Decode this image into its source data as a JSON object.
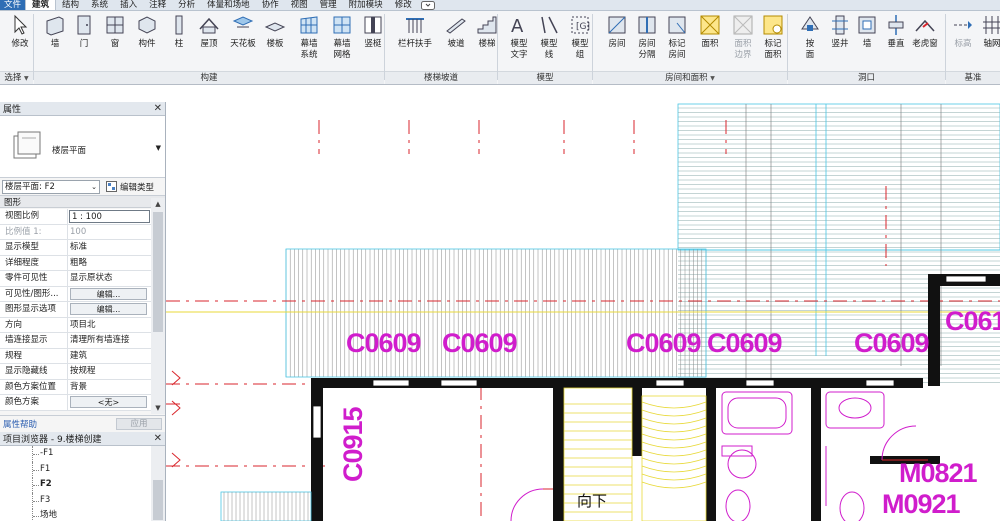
{
  "tabs": [
    "文件",
    "建筑",
    "结构",
    "系统",
    "插入",
    "注释",
    "分析",
    "体量和场地",
    "协作",
    "视图",
    "管理",
    "附加模块",
    "修改"
  ],
  "active_tab": "建筑",
  "ribbon": {
    "tools": [
      {
        "label": "修改",
        "icon": "cursor-icon"
      },
      {
        "label": "墙",
        "icon": "wall-icon"
      },
      {
        "label": "门",
        "icon": "door-icon"
      },
      {
        "label": "窗",
        "icon": "window-icon"
      },
      {
        "label": "构件",
        "icon": "component-icon"
      },
      {
        "label": "柱",
        "icon": "column-icon"
      },
      {
        "label": "屋顶",
        "icon": "roof-icon"
      },
      {
        "label": "天花板",
        "icon": "ceiling-icon"
      },
      {
        "label": "楼板",
        "icon": "floor-icon"
      },
      {
        "label": "幕墙\n系统",
        "icon": "curtain-system-icon"
      },
      {
        "label": "幕墙\n网格",
        "icon": "curtain-grid-icon"
      },
      {
        "label": "竖梃",
        "icon": "mullion-icon"
      },
      {
        "label": "栏杆扶手",
        "icon": "railing-icon"
      },
      {
        "label": "坡道",
        "icon": "ramp-icon"
      },
      {
        "label": "楼梯",
        "icon": "stair-icon"
      },
      {
        "label": "模型\n文字",
        "icon": "model-text-icon"
      },
      {
        "label": "模型\n线",
        "icon": "model-line-icon"
      },
      {
        "label": "模型\n组",
        "icon": "model-group-icon"
      },
      {
        "label": "房间",
        "icon": "room-icon"
      },
      {
        "label": "房间\n分隔",
        "icon": "room-separator-icon"
      },
      {
        "label": "标记\n房间",
        "icon": "tag-room-icon"
      },
      {
        "label": "面积",
        "icon": "area-icon"
      },
      {
        "label": "面积\n边界",
        "icon": "area-boundary-icon"
      },
      {
        "label": "标记\n面积",
        "icon": "tag-area-icon"
      },
      {
        "label": "按\n面",
        "icon": "by-face-icon"
      },
      {
        "label": "竖井",
        "icon": "shaft-icon"
      },
      {
        "label": "墙",
        "icon": "wall-opening-icon"
      },
      {
        "label": "垂直",
        "icon": "vertical-opening-icon"
      },
      {
        "label": "老虎窗",
        "icon": "dormer-icon"
      },
      {
        "label": "标高",
        "icon": "level-icon"
      },
      {
        "label": "轴网",
        "icon": "grid-icon"
      }
    ],
    "groups": [
      "选择",
      "构建",
      "楼梯坡道",
      "模型",
      "房间和面积",
      "洞口",
      "基准"
    ]
  },
  "properties": {
    "title": "属性",
    "type_name": "楼层平面",
    "filter": "楼层平面: F2",
    "edit_type": "编辑类型",
    "group": "图形",
    "rows": [
      {
        "k": "视图比例",
        "v": "1 : 100"
      },
      {
        "k": "比例值 1:",
        "v": "100"
      },
      {
        "k": "显示模型",
        "v": "标准"
      },
      {
        "k": "详细程度",
        "v": "粗略"
      },
      {
        "k": "零件可见性",
        "v": "显示原状态"
      },
      {
        "k": "可见性/图形...",
        "v": "编辑..."
      },
      {
        "k": "图形显示选项",
        "v": "编辑..."
      },
      {
        "k": "方向",
        "v": "项目北"
      },
      {
        "k": "墙连接显示",
        "v": "清理所有墙连接"
      },
      {
        "k": "规程",
        "v": "建筑"
      },
      {
        "k": "显示隐藏线",
        "v": "按规程"
      },
      {
        "k": "颜色方案位置",
        "v": "背景"
      },
      {
        "k": "颜色方案",
        "v": "<无>"
      }
    ],
    "help": "属性帮助",
    "apply": "应用"
  },
  "browser": {
    "title": "项目浏览器 - 9.楼梯创建",
    "items": [
      "-F1",
      "F1",
      "F2",
      "F3",
      "场地"
    ],
    "selected": "F2"
  },
  "canvas": {
    "tags": [
      "C0609",
      "C0609",
      "C0609",
      "C0609",
      "C0609",
      "C061",
      "C0915",
      "M0821",
      "M0921"
    ],
    "stair_text": "向下"
  },
  "colors": {
    "tag": "#d01dcc",
    "grid_red": "#d9262c",
    "cyan": "#49c6e5",
    "yellow": "#e8d93a",
    "ribbon_bg": "#f4f5f7",
    "file_tab": "#2f6eb5"
  }
}
